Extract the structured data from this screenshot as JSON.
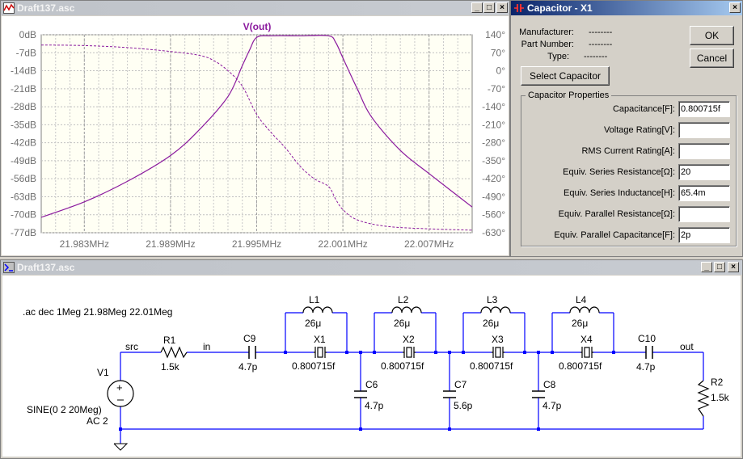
{
  "plot_window": {
    "title": "Draft137.asc",
    "trace_label": "V(out)",
    "y_ticks_left": [
      "0dB",
      "-7dB",
      "-14dB",
      "-21dB",
      "-28dB",
      "-35dB",
      "-42dB",
      "-49dB",
      "-56dB",
      "-63dB",
      "-70dB",
      "-77dB"
    ],
    "y_ticks_right": [
      "140°",
      "70°",
      "0°",
      "-70°",
      "-140°",
      "-210°",
      "-280°",
      "-350°",
      "-420°",
      "-490°",
      "-560°",
      "-630°"
    ],
    "x_ticks": [
      "21.983MHz",
      "21.989MHz",
      "21.995MHz",
      "22.001MHz",
      "22.007MHz"
    ],
    "colors": {
      "trace": "#8b1a9e",
      "background": "#ffffff",
      "plot_area": "#fffff0",
      "grid": "#b0b0b0"
    }
  },
  "chart_data": {
    "type": "line",
    "title": "V(out)",
    "x_unit": "MHz",
    "xlim": [
      21.98,
      22.01
    ],
    "ylim_left": [
      -77,
      0
    ],
    "ylim_right": [
      -630,
      140
    ],
    "grid": true,
    "series": [
      {
        "name": "V(out)",
        "style": "solid",
        "axis": "left",
        "x": [
          21.98,
          21.983,
          21.986,
          21.989,
          21.991,
          21.993,
          21.994,
          21.9945,
          21.995,
          21.996,
          21.998,
          22.0,
          22.0005,
          22.001,
          22.002,
          22.003,
          22.005,
          22.007,
          22.01
        ],
        "values": [
          -71,
          -65,
          -57,
          -47,
          -37,
          -24,
          -12,
          -6,
          -1,
          -0.4,
          -0.4,
          -0.4,
          -3,
          -9,
          -21,
          -32,
          -45,
          -54,
          -67
        ]
      },
      {
        "name": "",
        "style": "dashed",
        "axis": "right",
        "x": [
          21.98,
          21.983,
          21.986,
          21.989,
          21.991,
          21.992,
          21.993,
          21.994,
          21.995,
          21.996,
          21.997,
          21.998,
          21.999,
          22.0,
          22.0005,
          22.001,
          22.002,
          22.004,
          22.007,
          22.01
        ],
        "values": [
          100,
          98,
          90,
          75,
          60,
          40,
          0,
          -60,
          -170,
          -240,
          -300,
          -370,
          -420,
          -450,
          -500,
          -540,
          -580,
          -605,
          -615,
          -620
        ]
      }
    ]
  },
  "cap_dialog": {
    "title": "Capacitor - X1",
    "ok_label": "OK",
    "cancel_label": "Cancel",
    "manufacturer_label": "Manufacturer:",
    "part_number_label": "Part Number:",
    "type_label": "Type:",
    "manufacturer_value": "--------",
    "part_number_value": "--------",
    "type_value": "--------",
    "select_label": "Select Capacitor",
    "group_label": "Capacitor Properties",
    "props": [
      {
        "label": "Capacitance[F]:",
        "value": "0.800715f"
      },
      {
        "label": "Voltage Rating[V]:",
        "value": ""
      },
      {
        "label": "RMS Current Rating[A]:",
        "value": ""
      },
      {
        "label": "Equiv. Series Resistance[Ω]:",
        "value": "20"
      },
      {
        "label": "Equiv. Series Inductance[H]:",
        "value": "65.4m"
      },
      {
        "label": "Equiv. Parallel Resistance[Ω]:",
        "value": ""
      },
      {
        "label": "Equiv. Parallel Capacitance[F]:",
        "value": "2p"
      }
    ]
  },
  "schematic": {
    "title": "Draft137.asc",
    "directive": ".ac dec 1Meg 21.98Meg 22.01Meg",
    "v1": {
      "name": "V1",
      "value1": "SINE(0 2 20Meg)",
      "value2": "AC 2"
    },
    "r1": {
      "name": "R1",
      "value": "1.5k"
    },
    "r2": {
      "name": "R2",
      "value": "1.5k"
    },
    "c9": {
      "name": "C9",
      "value": "4.7p"
    },
    "c10": {
      "name": "C10",
      "value": "4.7p"
    },
    "nets": {
      "src": "src",
      "in": "in",
      "out": "out"
    },
    "inductors": [
      {
        "name": "L1",
        "value": "26μ"
      },
      {
        "name": "L2",
        "value": "26μ"
      },
      {
        "name": "L3",
        "value": "26μ"
      },
      {
        "name": "L4",
        "value": "26μ"
      }
    ],
    "crystals": [
      {
        "name": "X1",
        "value": "0.800715f"
      },
      {
        "name": "X2",
        "value": "0.800715f"
      },
      {
        "name": "X3",
        "value": "0.800715f"
      },
      {
        "name": "X4",
        "value": "0.800715f"
      }
    ],
    "shunt_caps": [
      {
        "name": "C6",
        "value": "4.7p"
      },
      {
        "name": "C7",
        "value": "5.6p"
      },
      {
        "name": "C8",
        "value": "4.7p"
      }
    ]
  }
}
